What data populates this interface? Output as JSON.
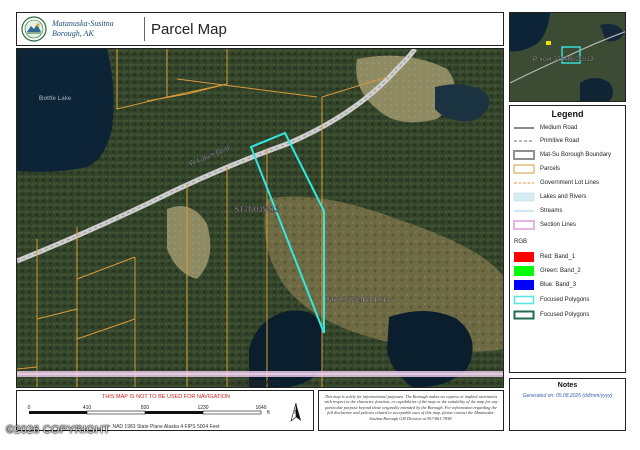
{
  "header": {
    "borough_name_line1": "Matanuska-Susitna",
    "borough_name_line2": "Borough, AK",
    "title": "Parcel Map"
  },
  "map": {
    "lake_label": "Bottle Lake",
    "road_label": "W Lakes Blvd",
    "section_center_label": "S17N04W13",
    "section_bottom_label": "S17N04W24",
    "parcel_label": "Parcel 5754B02L013"
  },
  "overview": {
    "parcel_label": "Parcel 5754B02L013"
  },
  "legend": {
    "title": "Legend",
    "items": [
      {
        "label": "Medium Road",
        "icon": "medium-road-line",
        "color": "#8a8a8a"
      },
      {
        "label": "Primitive Road",
        "icon": "primitive-road-dashed-line",
        "color": "#8a8a8a"
      },
      {
        "label": "Mat-Su Borough Boundary",
        "icon": "borough-boundary-box",
        "color": "#8f8f8f"
      },
      {
        "label": "Parcels",
        "icon": "parcel-box",
        "color": "#d79a3a"
      },
      {
        "label": "Government Lot Lines",
        "icon": "government-lot-dashed-line",
        "color": "#d79a3a"
      },
      {
        "label": "Lakes and Rivers",
        "icon": "lakes-box",
        "color": "#d6ecf3"
      },
      {
        "label": "Streams",
        "icon": "streams-line",
        "color": "#b9d6ee"
      },
      {
        "label": "Section Lines",
        "icon": "section-lines-box",
        "color": "#e6b6e0"
      }
    ],
    "rgb_heading": "RGB",
    "bands": [
      {
        "label": "Red:   Band_1",
        "color": "#ff0000"
      },
      {
        "label": "Green: Band_2",
        "color": "#00ff00"
      },
      {
        "label": "Blue:  Band_3",
        "color": "#0000ff"
      }
    ],
    "focused": [
      {
        "label": "Focused Polygons",
        "color": "#5fe4e4"
      },
      {
        "label": "Focused Polygons",
        "color": "#1f6b52"
      }
    ]
  },
  "notes": {
    "title": "Notes",
    "text": "Generated on: 05.08.2026  (dd/mm/yyyy)"
  },
  "footer": {
    "nav_warning": "THIS MAP IS NOT TO BE USED FOR NAVIGATION",
    "scale_ticks": [
      "0",
      "410",
      "820",
      "1230",
      "1640"
    ],
    "scale_unit": "ft",
    "projection": "NAD 1983 State Plane Alaska 4 FIPS 5004 Feet",
    "north_label": "N"
  },
  "disclaimer": "This map is solely for informational purposes. The Borough makes no express or implied warranties with respect to the character, function, or capabilities of the map or the suitability of the map for any particular purpose beyond those originally intended by the Borough. For information regarding the full disclaimer and policies related to acceptable uses of this map, please contact the Matanuska-Susitna Borough GIS Division at 907-861-7858.",
  "watermark": "©2026 COPYRIGHT",
  "colors": {
    "parcel_line": "#d79a3a",
    "focus_polygon": "#33e8e0",
    "section_line": "#f0c8ec",
    "road": "#cfcfcf",
    "forest": "#2f3d25",
    "lake": "#0d2436"
  }
}
